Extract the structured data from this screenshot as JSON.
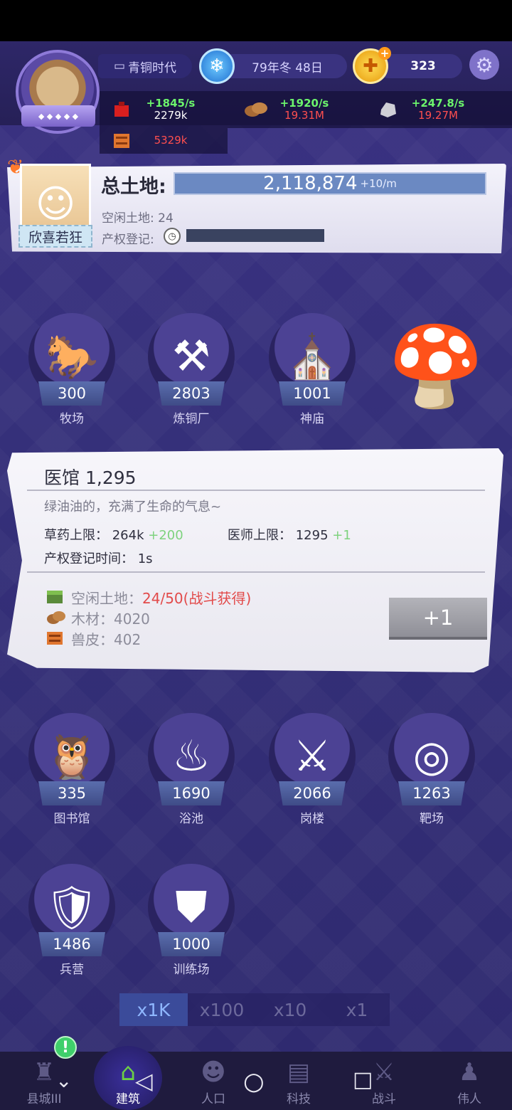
{
  "header": {
    "era": "青铜时代",
    "date": "79年冬 48日",
    "gold": "323",
    "icons": {
      "era": "bed-icon",
      "season": "snowflake-icon",
      "currency": "gold-coin-icon",
      "settings": "gear-icon"
    }
  },
  "resources": [
    {
      "name": "red-resource",
      "rate": "+1845/s",
      "amount": "2279k"
    },
    {
      "name": "wood",
      "rate": "+1920/s",
      "amount": "19.31M"
    },
    {
      "name": "stone",
      "rate": "+247.8/s",
      "amount": "19.27M"
    },
    {
      "name": "hide",
      "amount": "5329k"
    }
  ],
  "land": {
    "title": "总土地:",
    "total": "2,118,874",
    "rate": "+10/m",
    "idle": "空闲土地: 24",
    "register": "产权登记:",
    "character_label": "欣喜若狂",
    "register_progress": 0
  },
  "buildings_top": [
    {
      "count": "300",
      "name": "牧场"
    },
    {
      "count": "2803",
      "name": "炼铜厂"
    },
    {
      "count": "1001",
      "name": "神庙"
    }
  ],
  "detail": {
    "title": "医馆",
    "count": "1,295",
    "desc": "绿油油的，充满了生命的气息~",
    "herb_label": "草药上限：",
    "herb_value": "264k",
    "herb_plus": "+200",
    "doctor_label": "医师上限：",
    "doctor_value": "1295",
    "doctor_plus": "+1",
    "reg_time_label": "产权登记时间：",
    "reg_time_value": "1s",
    "req_land_label": "空闲土地：",
    "req_land_value": "24",
    "req_land_rest": "/50(战斗获得)",
    "req_wood_label": "木材：",
    "req_wood_value": "4020",
    "req_hide_label": "兽皮：",
    "req_hide_value": "402",
    "button": "+1"
  },
  "buildings_bottom": [
    {
      "count": "335",
      "name": "图书馆"
    },
    {
      "count": "1690",
      "name": "浴池"
    },
    {
      "count": "2066",
      "name": "岗楼"
    },
    {
      "count": "1263",
      "name": "靶场"
    },
    {
      "count": "1486",
      "name": "兵营"
    },
    {
      "count": "1000",
      "name": "训练场"
    }
  ],
  "multipliers": [
    "x1K",
    "x100",
    "x10",
    "x1"
  ],
  "nav": [
    "县城III",
    "建筑",
    "人口",
    "科技",
    "战斗",
    "伟人"
  ],
  "nav_badge": "!"
}
